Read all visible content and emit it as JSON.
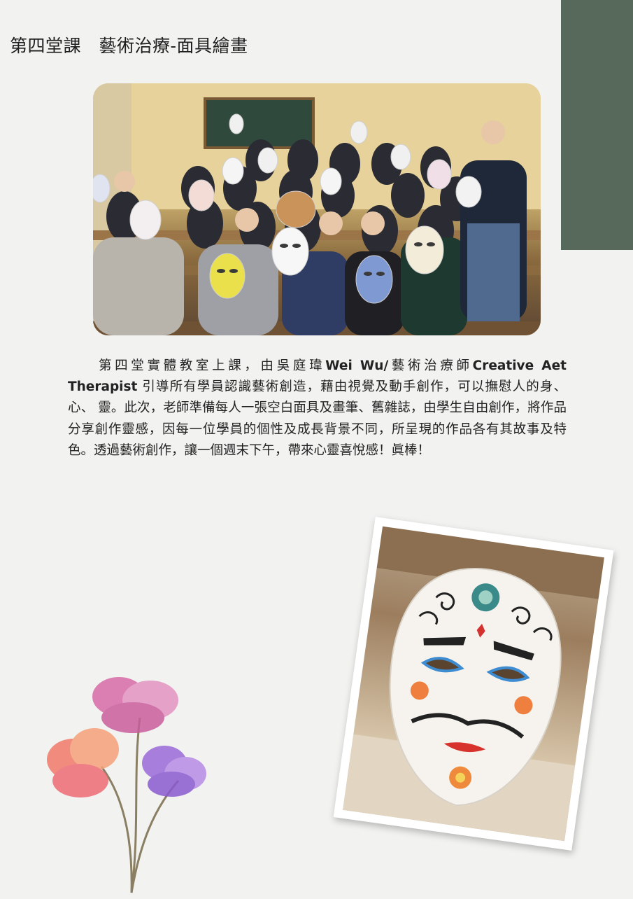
{
  "page": {
    "title": "第四堂課　藝術治療-面具繪畫",
    "body": {
      "p1": "第四堂實體教室上課，由吳庭瑋",
      "b1": "Wei Wu/",
      "p2": "藝術治療師",
      "b2": "Creative Aet Therapist",
      "p3": " 引導所有學員認識藝術創造，藉由視覺及動手創作，可以撫慰人的身、心、 靈。此次，老師準備每人一張空白面具及畫筆、舊雜誌，由學生自由創作，將作品分享創作靈感，因每一位學員的個性及成長背景不同，所呈現的作品各有其故事及特色。透過藝術創作，讓一個週末下午，帶來心靈喜悅感！眞棒！"
    }
  },
  "colors": {
    "background": "#f2f2f0",
    "accent_bar": "#56695a"
  },
  "images": {
    "group_photo": "group-of-students-holding-painted-masks",
    "mask_photo": "decorated-white-face-mask",
    "flowers": "watercolor-flowers"
  }
}
